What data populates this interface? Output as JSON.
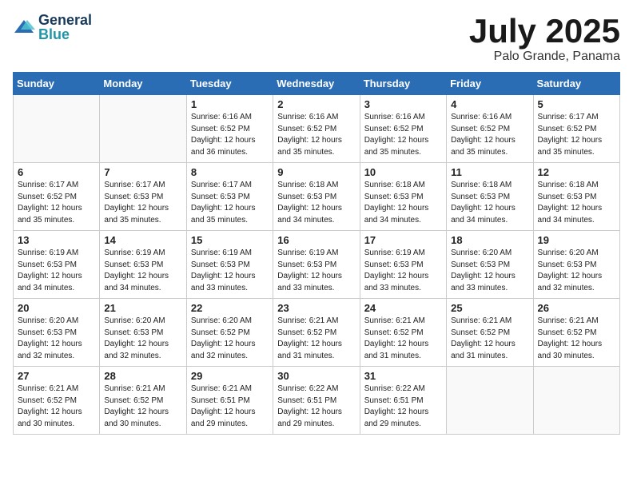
{
  "logo": {
    "general": "General",
    "blue": "Blue"
  },
  "header": {
    "month": "July 2025",
    "location": "Palo Grande, Panama"
  },
  "days_of_week": [
    "Sunday",
    "Monday",
    "Tuesday",
    "Wednesday",
    "Thursday",
    "Friday",
    "Saturday"
  ],
  "weeks": [
    [
      {
        "day": "",
        "info": ""
      },
      {
        "day": "",
        "info": ""
      },
      {
        "day": "1",
        "info": "Sunrise: 6:16 AM\nSunset: 6:52 PM\nDaylight: 12 hours and 36 minutes."
      },
      {
        "day": "2",
        "info": "Sunrise: 6:16 AM\nSunset: 6:52 PM\nDaylight: 12 hours and 35 minutes."
      },
      {
        "day": "3",
        "info": "Sunrise: 6:16 AM\nSunset: 6:52 PM\nDaylight: 12 hours and 35 minutes."
      },
      {
        "day": "4",
        "info": "Sunrise: 6:16 AM\nSunset: 6:52 PM\nDaylight: 12 hours and 35 minutes."
      },
      {
        "day": "5",
        "info": "Sunrise: 6:17 AM\nSunset: 6:52 PM\nDaylight: 12 hours and 35 minutes."
      }
    ],
    [
      {
        "day": "6",
        "info": "Sunrise: 6:17 AM\nSunset: 6:52 PM\nDaylight: 12 hours and 35 minutes."
      },
      {
        "day": "7",
        "info": "Sunrise: 6:17 AM\nSunset: 6:53 PM\nDaylight: 12 hours and 35 minutes."
      },
      {
        "day": "8",
        "info": "Sunrise: 6:17 AM\nSunset: 6:53 PM\nDaylight: 12 hours and 35 minutes."
      },
      {
        "day": "9",
        "info": "Sunrise: 6:18 AM\nSunset: 6:53 PM\nDaylight: 12 hours and 34 minutes."
      },
      {
        "day": "10",
        "info": "Sunrise: 6:18 AM\nSunset: 6:53 PM\nDaylight: 12 hours and 34 minutes."
      },
      {
        "day": "11",
        "info": "Sunrise: 6:18 AM\nSunset: 6:53 PM\nDaylight: 12 hours and 34 minutes."
      },
      {
        "day": "12",
        "info": "Sunrise: 6:18 AM\nSunset: 6:53 PM\nDaylight: 12 hours and 34 minutes."
      }
    ],
    [
      {
        "day": "13",
        "info": "Sunrise: 6:19 AM\nSunset: 6:53 PM\nDaylight: 12 hours and 34 minutes."
      },
      {
        "day": "14",
        "info": "Sunrise: 6:19 AM\nSunset: 6:53 PM\nDaylight: 12 hours and 34 minutes."
      },
      {
        "day": "15",
        "info": "Sunrise: 6:19 AM\nSunset: 6:53 PM\nDaylight: 12 hours and 33 minutes."
      },
      {
        "day": "16",
        "info": "Sunrise: 6:19 AM\nSunset: 6:53 PM\nDaylight: 12 hours and 33 minutes."
      },
      {
        "day": "17",
        "info": "Sunrise: 6:19 AM\nSunset: 6:53 PM\nDaylight: 12 hours and 33 minutes."
      },
      {
        "day": "18",
        "info": "Sunrise: 6:20 AM\nSunset: 6:53 PM\nDaylight: 12 hours and 33 minutes."
      },
      {
        "day": "19",
        "info": "Sunrise: 6:20 AM\nSunset: 6:53 PM\nDaylight: 12 hours and 32 minutes."
      }
    ],
    [
      {
        "day": "20",
        "info": "Sunrise: 6:20 AM\nSunset: 6:53 PM\nDaylight: 12 hours and 32 minutes."
      },
      {
        "day": "21",
        "info": "Sunrise: 6:20 AM\nSunset: 6:53 PM\nDaylight: 12 hours and 32 minutes."
      },
      {
        "day": "22",
        "info": "Sunrise: 6:20 AM\nSunset: 6:52 PM\nDaylight: 12 hours and 32 minutes."
      },
      {
        "day": "23",
        "info": "Sunrise: 6:21 AM\nSunset: 6:52 PM\nDaylight: 12 hours and 31 minutes."
      },
      {
        "day": "24",
        "info": "Sunrise: 6:21 AM\nSunset: 6:52 PM\nDaylight: 12 hours and 31 minutes."
      },
      {
        "day": "25",
        "info": "Sunrise: 6:21 AM\nSunset: 6:52 PM\nDaylight: 12 hours and 31 minutes."
      },
      {
        "day": "26",
        "info": "Sunrise: 6:21 AM\nSunset: 6:52 PM\nDaylight: 12 hours and 30 minutes."
      }
    ],
    [
      {
        "day": "27",
        "info": "Sunrise: 6:21 AM\nSunset: 6:52 PM\nDaylight: 12 hours and 30 minutes."
      },
      {
        "day": "28",
        "info": "Sunrise: 6:21 AM\nSunset: 6:52 PM\nDaylight: 12 hours and 30 minutes."
      },
      {
        "day": "29",
        "info": "Sunrise: 6:21 AM\nSunset: 6:51 PM\nDaylight: 12 hours and 29 minutes."
      },
      {
        "day": "30",
        "info": "Sunrise: 6:22 AM\nSunset: 6:51 PM\nDaylight: 12 hours and 29 minutes."
      },
      {
        "day": "31",
        "info": "Sunrise: 6:22 AM\nSunset: 6:51 PM\nDaylight: 12 hours and 29 minutes."
      },
      {
        "day": "",
        "info": ""
      },
      {
        "day": "",
        "info": ""
      }
    ]
  ]
}
